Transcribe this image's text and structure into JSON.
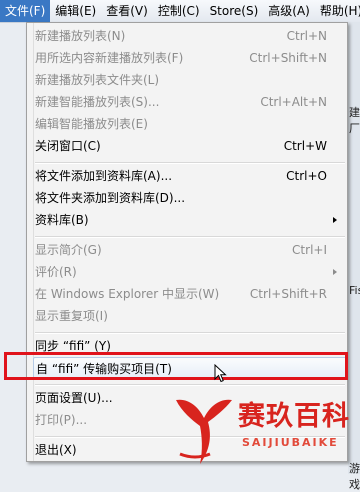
{
  "menubar": {
    "items": [
      {
        "label": "文件(F)",
        "active": true
      },
      {
        "label": "编辑(E)",
        "active": false
      },
      {
        "label": "查看(V)",
        "active": false
      },
      {
        "label": "控制(C)",
        "active": false
      },
      {
        "label": "Store(S)",
        "active": false
      },
      {
        "label": "高级(A)",
        "active": false
      },
      {
        "label": "帮助(H)",
        "active": false
      }
    ]
  },
  "background": {
    "fragments": [
      "建厂",
      "Fis",
      "游戏"
    ]
  },
  "file_menu": {
    "items": [
      {
        "label": "新建播放列表(N)",
        "shortcut": "Ctrl+N",
        "disabled": true
      },
      {
        "label": "用所选内容新建播放列表(F)",
        "shortcut": "Ctrl+Shift+N",
        "disabled": true
      },
      {
        "label": "新建播放列表文件夹(L)",
        "shortcut": "",
        "disabled": true
      },
      {
        "label": "新建智能播放列表(S)...",
        "shortcut": "Ctrl+Alt+N",
        "disabled": true
      },
      {
        "label": "编辑智能播放列表(E)",
        "shortcut": "",
        "disabled": true
      },
      {
        "label": "关闭窗口(C)",
        "shortcut": "Ctrl+W",
        "disabled": false
      },
      {
        "label": "将文件添加到资料库(A)...",
        "shortcut": "Ctrl+O",
        "disabled": false
      },
      {
        "label": "将文件夹添加到资料库(D)...",
        "shortcut": "",
        "disabled": false
      },
      {
        "label": "资料库(B)",
        "shortcut": "",
        "disabled": false,
        "submenu": true
      },
      {
        "label": "显示简介(G)",
        "shortcut": "Ctrl+I",
        "disabled": true
      },
      {
        "label": "评价(R)",
        "shortcut": "",
        "disabled": true,
        "submenu": true
      },
      {
        "label": "在 Windows Explorer 中显示(W)",
        "shortcut": "Ctrl+Shift+R",
        "disabled": true
      },
      {
        "label": "显示重复项(I)",
        "shortcut": "",
        "disabled": true
      },
      {
        "label": "同步 “fifi” (Y)",
        "shortcut": "",
        "disabled": false
      },
      {
        "label": "自 “fifi” 传输购买项目(T)",
        "shortcut": "",
        "disabled": false,
        "highlighted": true
      },
      {
        "label": "页面设置(U)...",
        "shortcut": "",
        "disabled": false
      },
      {
        "label": "打印(P)...",
        "shortcut": "",
        "disabled": true
      },
      {
        "label": "退出(X)",
        "shortcut": "",
        "disabled": false
      }
    ]
  },
  "watermark": {
    "title": "赛玖百科",
    "subtitle": "SAIJIUBAIKE"
  },
  "colors": {
    "menubar_active": "#3a78c4",
    "annotation_red": "#e0131b",
    "disabled_text": "#8c8c8c",
    "watermark_red": "#d8241e"
  }
}
